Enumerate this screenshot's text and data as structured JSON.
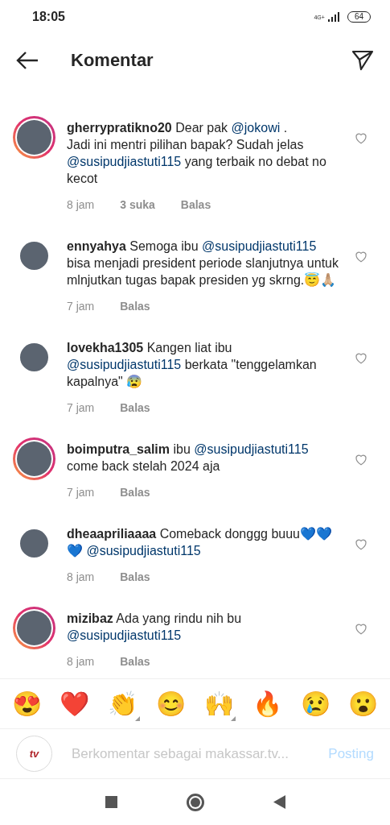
{
  "status_bar": {
    "time": "18:05",
    "network": "4G+",
    "battery": "64"
  },
  "header": {
    "title": "Komentar"
  },
  "comments": [
    {
      "username": "gherrypratikno20",
      "story_ring": true,
      "liked": false,
      "segments": [
        {
          "kind": "text",
          "text": "Dear pak "
        },
        {
          "kind": "mention",
          "text": "@jokowi"
        },
        {
          "kind": "text",
          "text": " .\nJadi ini mentri pilihan bapak? Sudah jelas "
        },
        {
          "kind": "mention",
          "text": "@susipudjiastuti115"
        },
        {
          "kind": "text",
          "text": " yang terbaik no debat no kecot"
        }
      ],
      "time": "8 jam",
      "likes": "3 suka",
      "reply": "Balas"
    },
    {
      "username": "ennyahya",
      "story_ring": false,
      "liked": false,
      "segments": [
        {
          "kind": "text",
          "text": "Semoga ibu "
        },
        {
          "kind": "mention",
          "text": "@susipudjiastuti115"
        },
        {
          "kind": "text",
          "text": " bisa menjadi president periode slanjutnya untuk mlnjutkan tugas bapak presiden yg skrng.😇🙏🏼"
        }
      ],
      "time": "7 jam",
      "reply": "Balas"
    },
    {
      "username": "lovekha1305",
      "story_ring": false,
      "liked": false,
      "segments": [
        {
          "kind": "text",
          "text": "Kangen liat ibu "
        },
        {
          "kind": "mention",
          "text": "@susipudjiastuti115"
        },
        {
          "kind": "text",
          "text": " berkata \"tenggelamkan kapalnya\" 😰"
        }
      ],
      "time": "7 jam",
      "reply": "Balas"
    },
    {
      "username": "boimputra_salim",
      "story_ring": true,
      "liked": false,
      "segments": [
        {
          "kind": "text",
          "text": "ibu "
        },
        {
          "kind": "mention",
          "text": "@susipudjiastuti115"
        },
        {
          "kind": "text",
          "text": "\ncome back stelah 2024 aja"
        }
      ],
      "time": "7 jam",
      "reply": "Balas"
    },
    {
      "username": "dheaapriliaaaa",
      "story_ring": false,
      "liked": false,
      "segments": [
        {
          "kind": "text",
          "text": "Comeback donggg buuu💙💙💙 "
        },
        {
          "kind": "mention",
          "text": "@susipudjiastuti115"
        }
      ],
      "time": "8 jam",
      "reply": "Balas"
    },
    {
      "username": "mizibaz",
      "story_ring": true,
      "liked": false,
      "segments": [
        {
          "kind": "text",
          "text": "Ada yang rindu nih bu\n"
        },
        {
          "kind": "mention",
          "text": "@susipudjiastuti115"
        }
      ],
      "time": "8 jam",
      "reply": "Balas"
    }
  ],
  "emoji_bar": [
    {
      "emoji": "😍",
      "has_variants": false
    },
    {
      "emoji": "❤️",
      "has_variants": false
    },
    {
      "emoji": "👏",
      "has_variants": true
    },
    {
      "emoji": "😊",
      "has_variants": false
    },
    {
      "emoji": "🙌",
      "has_variants": true
    },
    {
      "emoji": "🔥",
      "has_variants": false
    },
    {
      "emoji": "😢",
      "has_variants": false
    },
    {
      "emoji": "😮",
      "has_variants": false
    }
  ],
  "composer": {
    "placeholder": "Berkomentar sebagai makassar.tv...",
    "post": "Posting",
    "avatar_text": "tv"
  }
}
